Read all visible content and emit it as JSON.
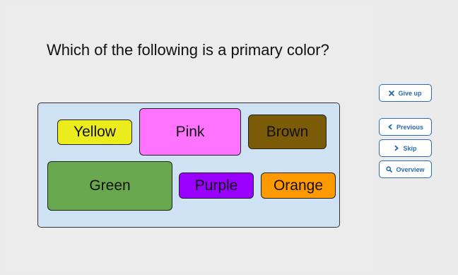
{
  "question": {
    "text": "Which of the following is a primary color?"
  },
  "choices": [
    {
      "label": "Yellow",
      "color": "#ecec1c"
    },
    {
      "label": "Pink",
      "color": "#ff73ff"
    },
    {
      "label": "Brown",
      "color": "#7b5b08"
    },
    {
      "label": "Green",
      "color": "#6aa84f"
    },
    {
      "label": "Purple",
      "color": "#9900ff"
    },
    {
      "label": "Orange",
      "color": "#ff9900"
    }
  ],
  "sidebar": {
    "give_up": {
      "label": "Give up",
      "icon": "close-icon"
    },
    "previous": {
      "label": "Previous",
      "icon": "chevron-left-icon"
    },
    "skip": {
      "label": "Skip",
      "icon": "chevron-right-icon"
    },
    "overview": {
      "label": "Overview",
      "icon": "search-icon"
    }
  },
  "colors": {
    "accent": "#2b6cb0",
    "answer_area_background": "#cfe2f3",
    "page_background": "#ebebeb"
  }
}
